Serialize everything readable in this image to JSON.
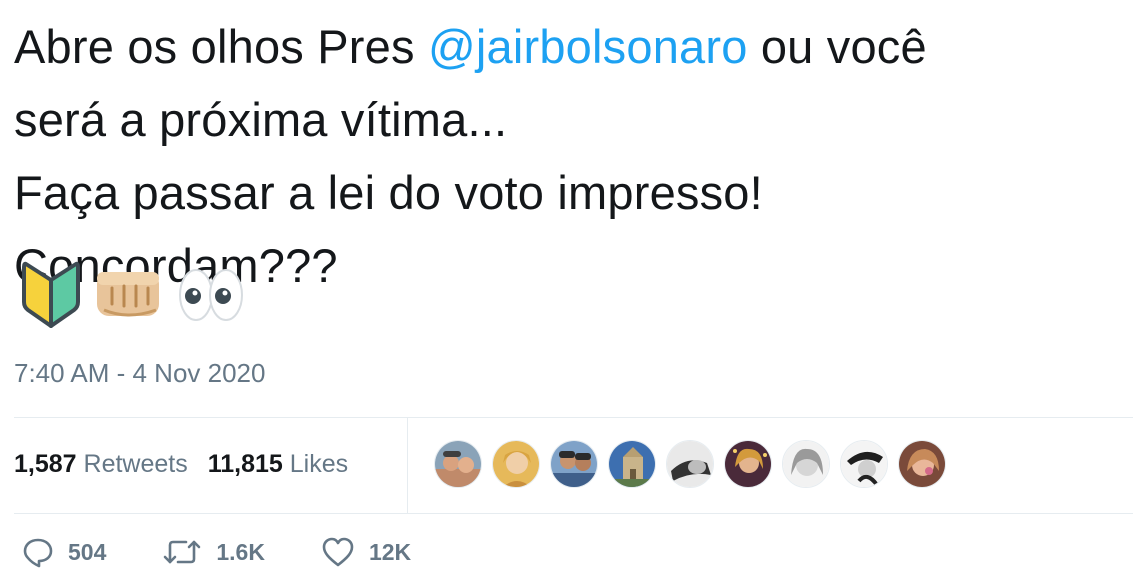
{
  "tweet": {
    "line1_pre": "Abre os olhos Pres ",
    "mention": "@jairbolsonaro",
    "line1_post": " ou você",
    "line2": "será a próxima vítima...",
    "line3": "Faça passar a lei do voto impresso!",
    "line4": "Concordam???",
    "emojis": [
      "beginner-symbol-icon",
      "oncoming-fist-icon",
      "eyes-icon"
    ],
    "timestamp": "7:40 AM - 4 Nov 2020"
  },
  "stats": {
    "retweets_count": "1,587",
    "retweets_label": "Retweets",
    "likes_count": "11,815",
    "likes_label": "Likes"
  },
  "liked_by_avatars": [
    "avatar-1",
    "avatar-2",
    "avatar-3",
    "avatar-4",
    "avatar-5",
    "avatar-6",
    "avatar-7",
    "avatar-8",
    "avatar-9"
  ],
  "actions": {
    "replies": "504",
    "retweets": "1.6K",
    "likes": "12K"
  },
  "colors": {
    "text": "#14171a",
    "mention": "#1da1f2",
    "secondary": "#657786",
    "divider": "#e6ecf0"
  }
}
